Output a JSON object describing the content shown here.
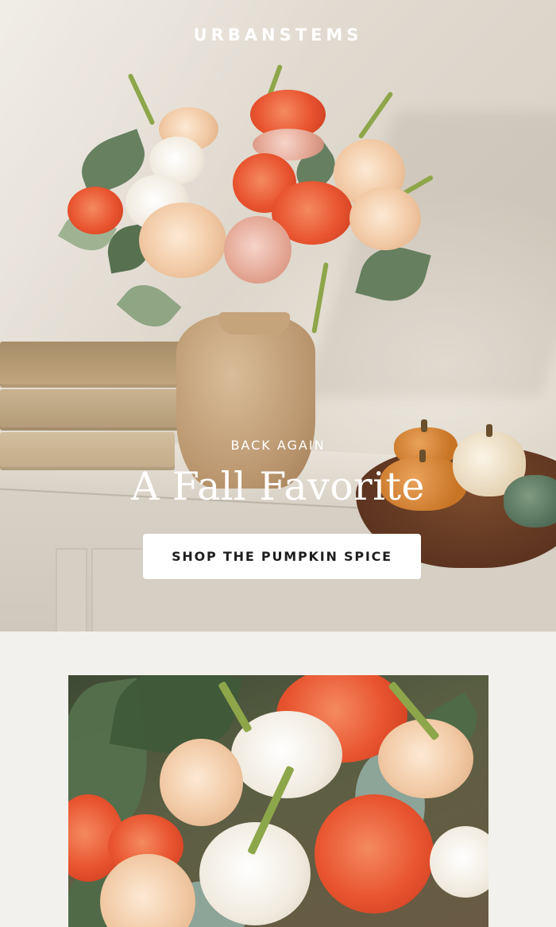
{
  "brand": {
    "name": "URBANSTEMS"
  },
  "hero": {
    "eyebrow": "BACK AGAIN",
    "headline": "A Fall Favorite",
    "cta_label": "SHOP THE PUMPKIN SPICE"
  },
  "colors": {
    "page_background": "#f2f1ed",
    "cta_background": "#ffffff",
    "cta_text": "#1e1e1e",
    "hero_text": "#ffffff"
  }
}
